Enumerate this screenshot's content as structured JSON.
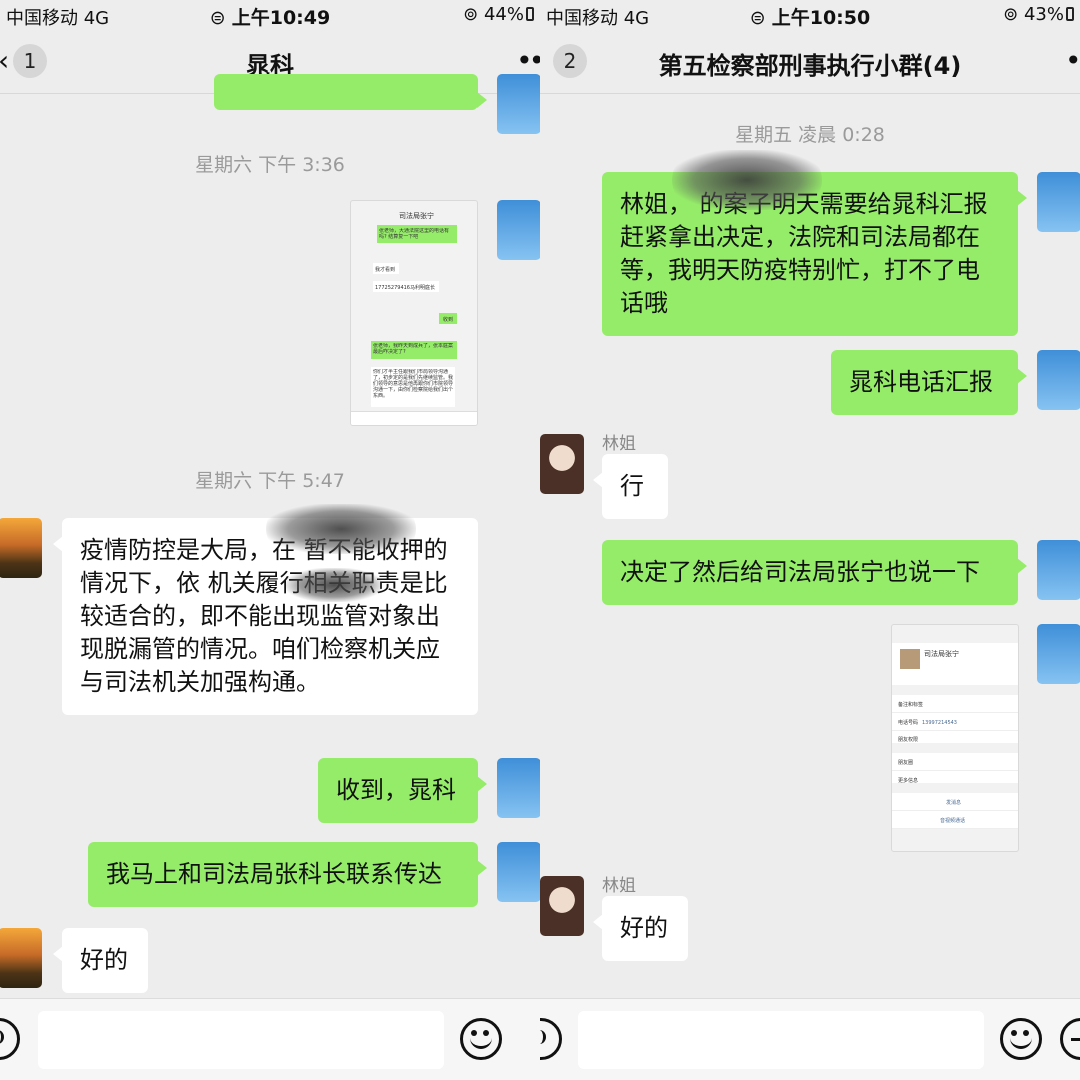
{
  "left": {
    "status": {
      "carrier": "中国移动 4G",
      "time": "上午10:49",
      "battery": "44%"
    },
    "nav": {
      "badge": "1",
      "title": "晁科"
    },
    "timestamps": [
      "星期六 下午 3:36",
      "星期六 下午 5:47"
    ],
    "messages": [
      {
        "text": "疫情防控是大局，在 暂不能收押的情况下，依 机关履行相关职责是比较适合的，即不能出现监管对象出现脱漏管的情况。咱们检察机关应与司法机关加强构通。"
      },
      {
        "text": "收到，晁科"
      },
      {
        "text": "我马上和司法局张科长联系传达"
      },
      {
        "text": "好的"
      }
    ],
    "shot": {
      "title": "司法局张宁",
      "m1": "张老师，大通法院这里的电话有吗? 结算复一下吧",
      "m2": "我才看到",
      "m3": "17725279416马利明庭长",
      "m4": "收到",
      "m5": "张老师，我昨天到成兵了，张本庭案最后咋决定了?",
      "m6": "你们才半主任跟我们市局领导沟通了，初步定的是我们先继续监管。我们领导的意思是他再跟你们市院领导沟通一下，由你们检察院给我们出个东西。"
    }
  },
  "right": {
    "status": {
      "carrier": "中国移动 4G",
      "time": "上午10:50",
      "battery": "43%"
    },
    "nav": {
      "badge": "2",
      "title": "第五检察部刑事执行小群(4)"
    },
    "timestamps": [
      "星期五 凌晨 0:28"
    ],
    "messages": [
      {
        "text": "林姐， 的案子明天需要给晁科汇报赶紧拿出决定，法院和司法局都在等，我明天防疫特别忙，打不了电话哦"
      },
      {
        "text": "晁科电话汇报"
      },
      {
        "sender": "林姐",
        "text": "行"
      },
      {
        "text": "决定了然后给司法局张宁也说一下"
      },
      {
        "sender": "林姐",
        "text": "好的"
      }
    ],
    "card": {
      "name": "司法局张宁",
      "r1": "备注和标签",
      "r2": "电话号码",
      "phone": "13997214543",
      "r3": "朋友权限",
      "r4": "朋友圈",
      "r5": "更多信息",
      "b1": "发消息",
      "b2": "音视频通话"
    }
  }
}
